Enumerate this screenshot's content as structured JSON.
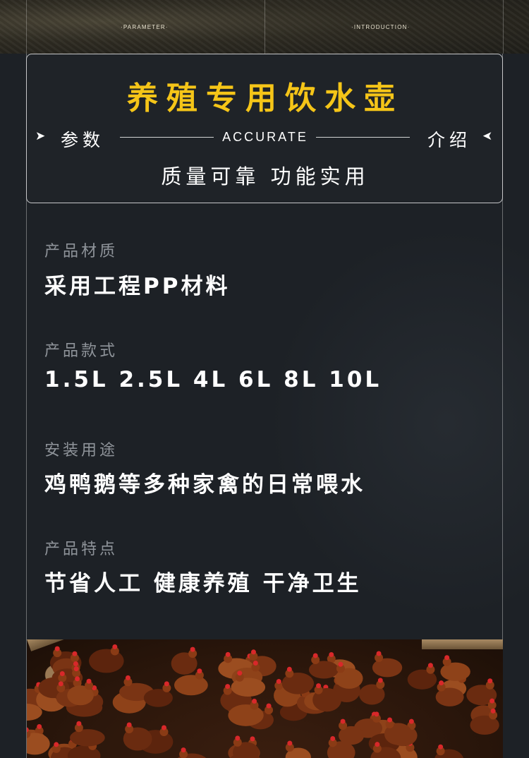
{
  "top_strip": {
    "left_label": "·PARAMETER·",
    "right_label": "·INTRODUCTION·"
  },
  "title_box": {
    "title": "养殖专用饮水壶",
    "left_label": "参数",
    "center_label": "ACCURATE",
    "right_label": "介绍",
    "left_arrow": "➤",
    "right_arrow": "➤",
    "subtitle": "质量可靠 功能实用"
  },
  "params": [
    {
      "label": "产品材质",
      "value": "采用工程PP材料"
    },
    {
      "label": "产品款式",
      "value": "1.5L 2.5L 4L 6L 8L 10L"
    },
    {
      "label": "安装用途",
      "value": "鸡鸭鹅等多种家禽的日常喂水"
    },
    {
      "label": "产品特点",
      "value": "节省人工 健康养殖 干净卫生"
    }
  ],
  "colors": {
    "title_yellow": "#f5c518",
    "background": "#1d2126",
    "label_gray": "#8f949a"
  },
  "photo": {
    "icon": "chickens-photo"
  }
}
